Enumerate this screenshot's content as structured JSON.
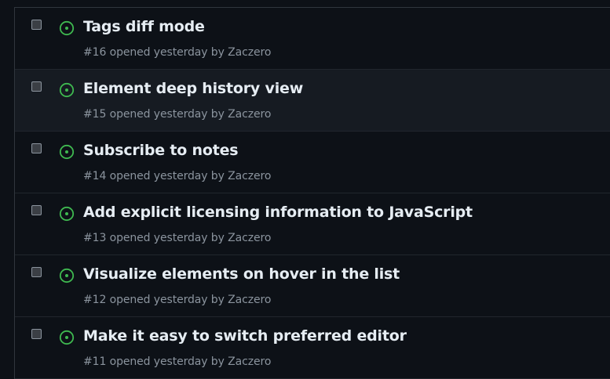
{
  "colors": {
    "open_icon": "#3fb950",
    "title": "#e6edf3",
    "meta": "#8b949e",
    "background": "#0d1117",
    "row_hover": "#161b22"
  },
  "issues": [
    {
      "title": "Tags diff mode",
      "number": "#16",
      "opened": "opened yesterday by",
      "author": "Zaczero",
      "icon": "issue-opened-icon"
    },
    {
      "title": "Element deep history view",
      "number": "#15",
      "opened": "opened yesterday by",
      "author": "Zaczero",
      "icon": "issue-opened-icon"
    },
    {
      "title": "Subscribe to notes",
      "number": "#14",
      "opened": "opened yesterday by",
      "author": "Zaczero",
      "icon": "issue-opened-icon"
    },
    {
      "title": "Add explicit licensing information to JavaScript",
      "number": "#13",
      "opened": "opened yesterday by",
      "author": "Zaczero",
      "icon": "issue-opened-icon"
    },
    {
      "title": "Visualize elements on hover in the list",
      "number": "#12",
      "opened": "opened yesterday by",
      "author": "Zaczero",
      "icon": "issue-opened-icon"
    },
    {
      "title": "Make it easy to switch preferred editor",
      "number": "#11",
      "opened": "opened yesterday by",
      "author": "Zaczero",
      "icon": "issue-opened-icon"
    }
  ]
}
